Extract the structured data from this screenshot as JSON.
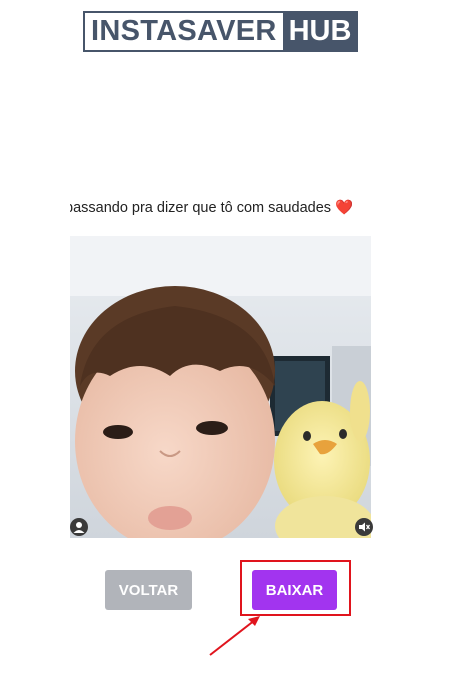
{
  "logo": {
    "left": "INSTASAVER",
    "right": "HUB"
  },
  "post": {
    "caption": "passando pra dizer que tô com saudades ❤️"
  },
  "actions": {
    "back_label": "VOLTAR",
    "download_label": "BAIXAR"
  },
  "colors": {
    "logo_dark": "#47556a",
    "download_button": "#a234ef",
    "back_button": "#b1b4ba",
    "annotation": "#e0141d"
  }
}
